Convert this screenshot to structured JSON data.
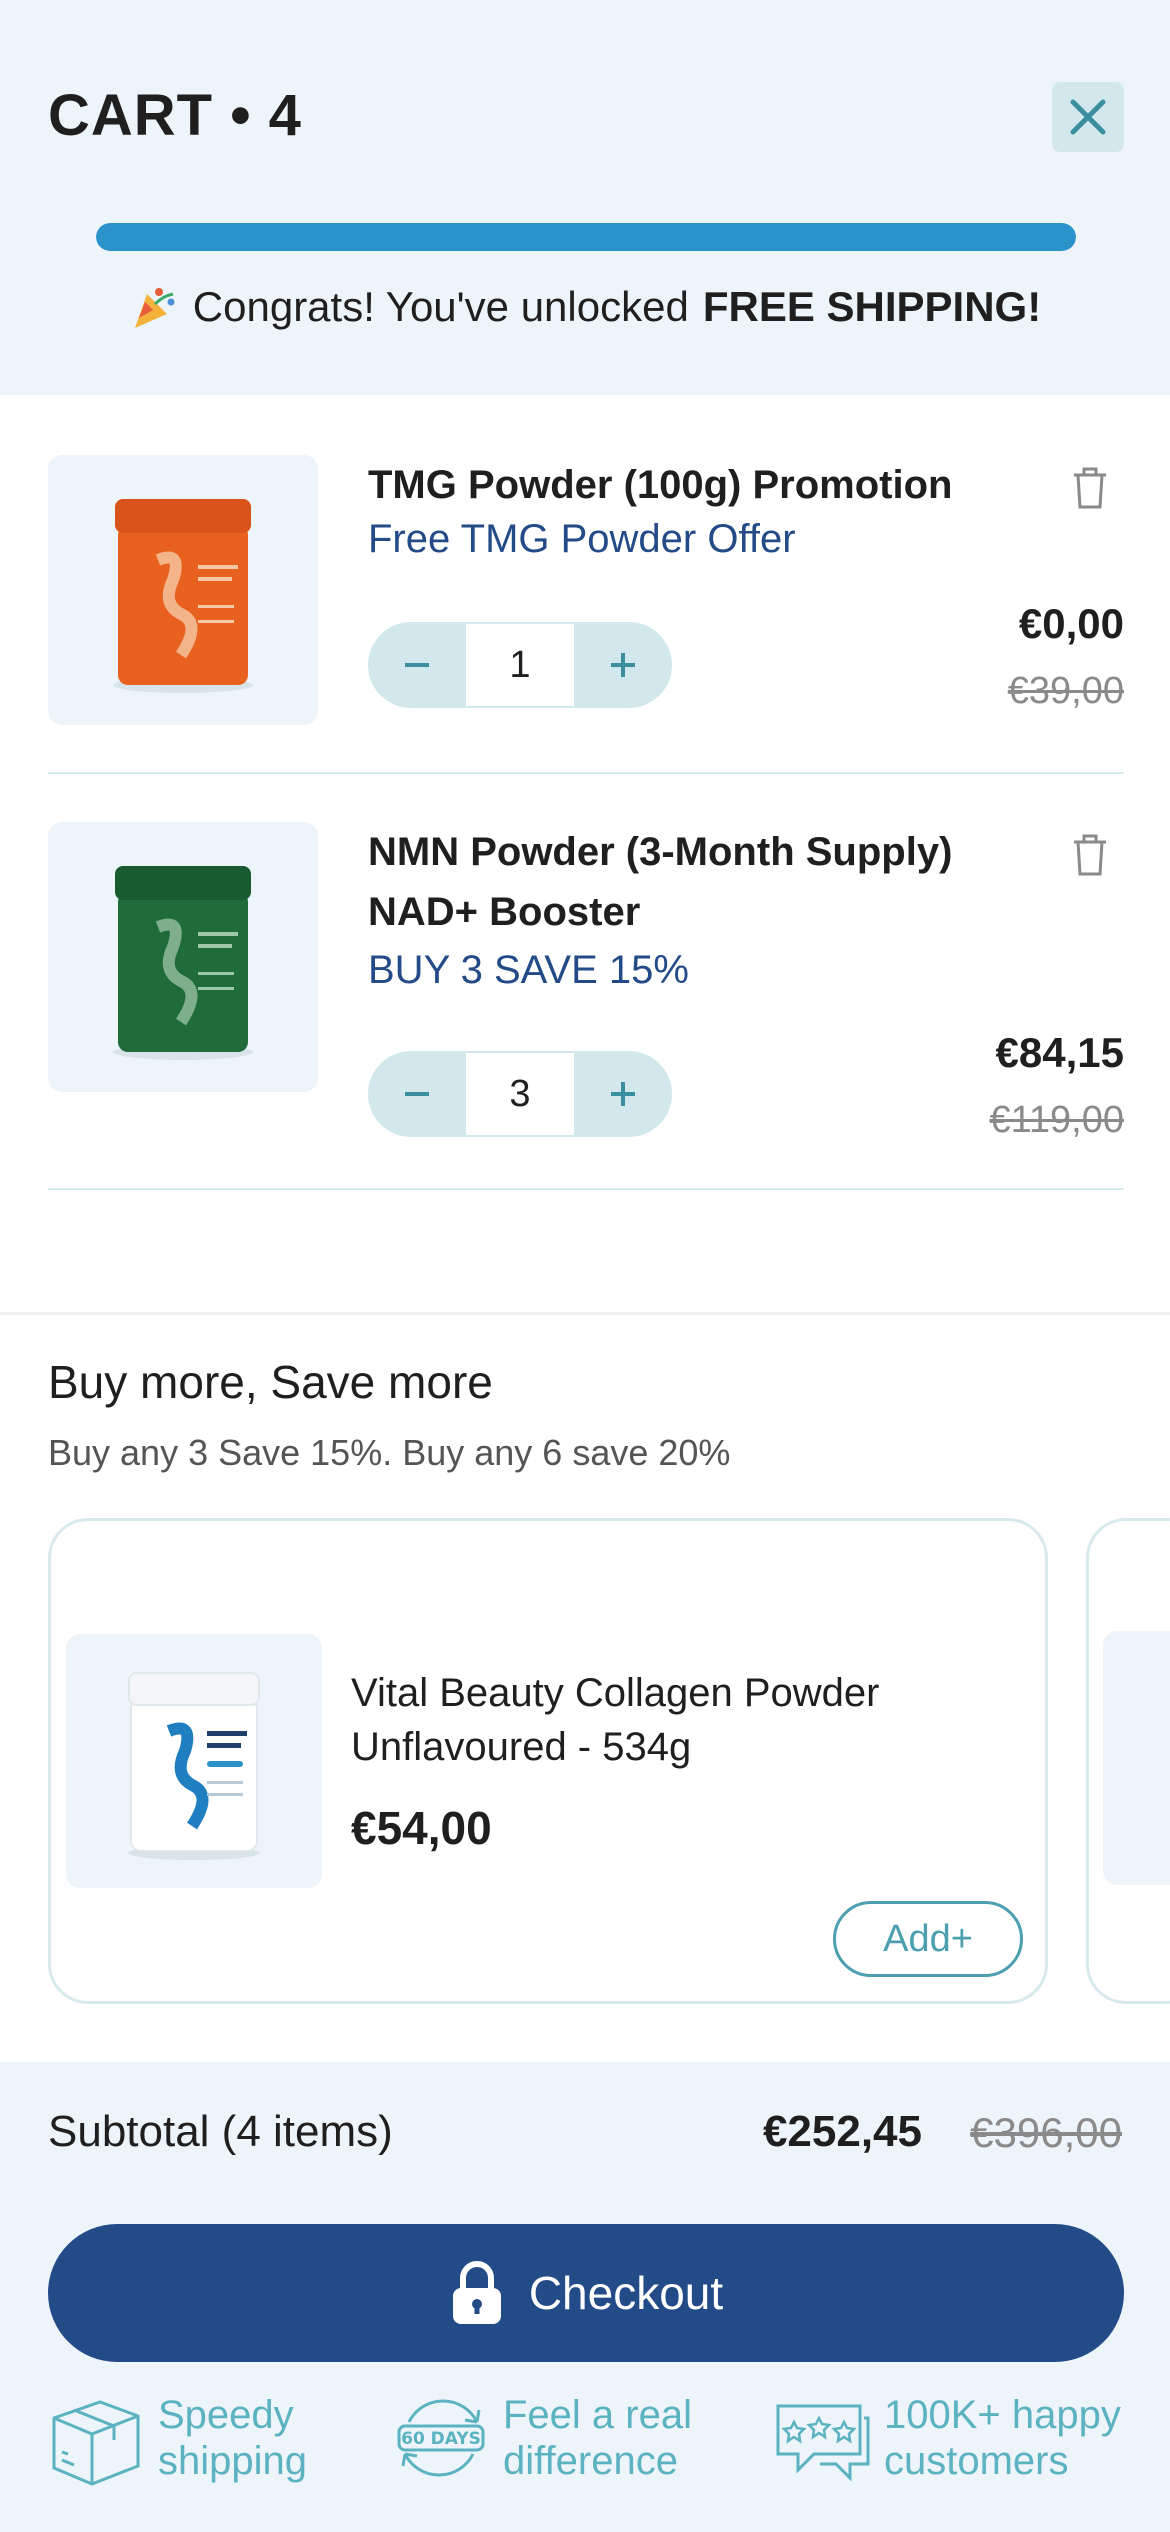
{
  "header": {
    "title": "CART • 4",
    "progress_fraction": 1.0,
    "congrats_prefix": "Congrats! You've unlocked",
    "congrats_highlight": "FREE SHIPPING!"
  },
  "items": [
    {
      "title": "TMG Powder (100g) Promotion",
      "offer": "Free TMG Powder Offer",
      "quantity": "1",
      "price": "€0,00",
      "old_price": "€39,00",
      "image_color": "#e8611f"
    },
    {
      "title_line1": "NMN Powder (3-Month Supply)",
      "title_line2": "NAD+ Booster",
      "offer": "BUY 3 SAVE 15%",
      "quantity": "3",
      "price": "€84,15",
      "old_price": "€119,00",
      "image_color": "#1f6b3a"
    }
  ],
  "upsell": {
    "title": "Buy more, Save more",
    "subtitle": "Buy any 3 Save 15%. Buy any 6 save 20%",
    "card": {
      "name": "Vital Beauty Collagen Powder Unflavoured - 534g",
      "price": "€54,00",
      "add_label": "Add+",
      "image_color": "#ffffff"
    }
  },
  "footer": {
    "subtotal_label": "Subtotal (4 items)",
    "subtotal_price": "€252,45",
    "subtotal_old_price": "€396,00",
    "checkout_label": "Checkout",
    "perks": [
      {
        "line1": "Speedy",
        "line2": "shipping",
        "icon": "box-icon"
      },
      {
        "line1": "Feel a real",
        "line2": "difference",
        "icon": "sixty-days-icon",
        "badge": "60 DAYS"
      },
      {
        "line1": "100K+ happy",
        "line2": "customers",
        "icon": "chat-stars-icon"
      }
    ]
  },
  "colors": {
    "accent_blue": "#2a93c9",
    "navy": "#234b87",
    "teal": "#4b9fae",
    "light_bg": "#eef5fa"
  }
}
